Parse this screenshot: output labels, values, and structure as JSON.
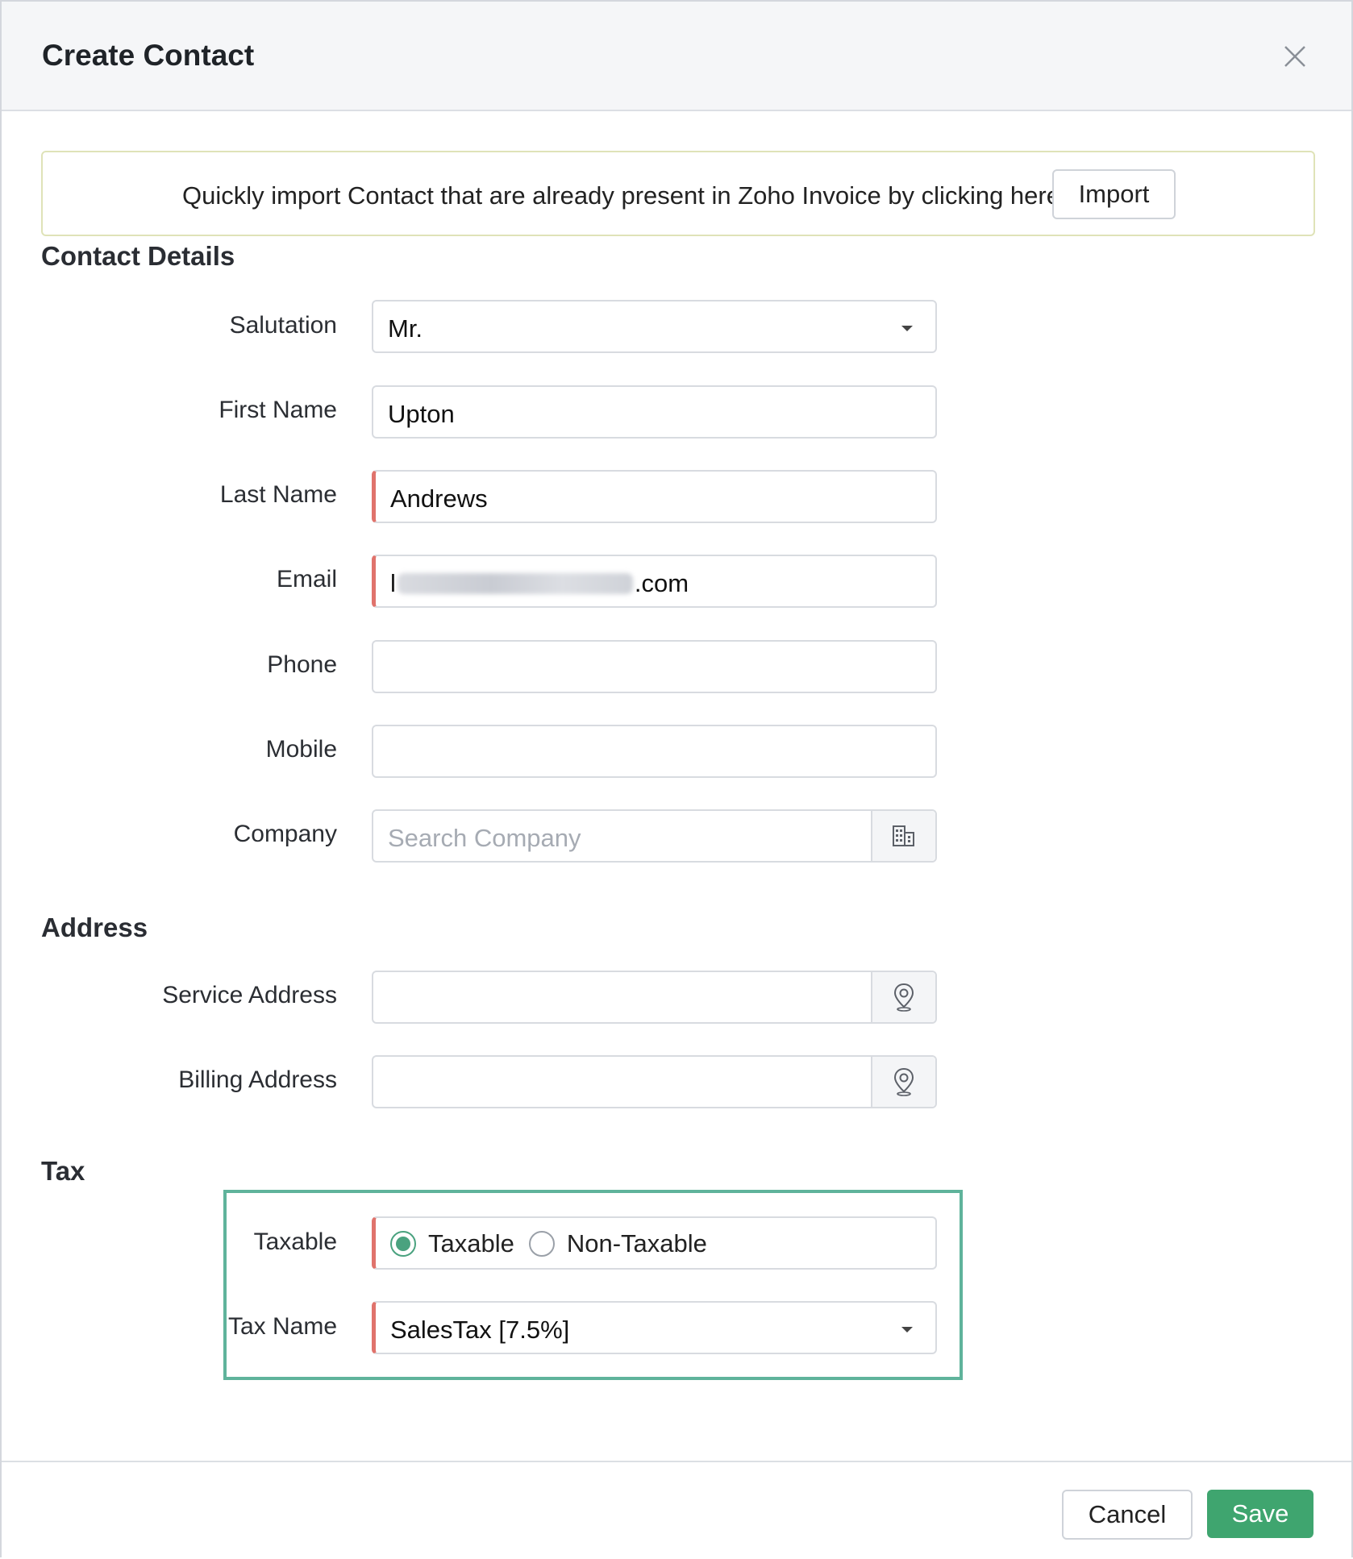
{
  "dialog": {
    "title": "Create Contact",
    "close_icon": "close-icon"
  },
  "import_banner": {
    "message": "Quickly import Contact that are already present in Zoho Invoice by clicking here",
    "button_label": "Import"
  },
  "contact_details": {
    "section_title": "Contact Details",
    "salutation": {
      "label": "Salutation",
      "value": "Mr."
    },
    "first_name": {
      "label": "First Name",
      "value": "Upton"
    },
    "last_name": {
      "label": "Last Name",
      "value": "Andrews"
    },
    "email": {
      "label": "Email",
      "value_start": "l",
      "value_end": ".com"
    },
    "phone": {
      "label": "Phone",
      "value": ""
    },
    "mobile": {
      "label": "Mobile",
      "value": ""
    },
    "company": {
      "label": "Company",
      "placeholder": "Search Company",
      "icon": "building-icon"
    }
  },
  "address": {
    "section_title": "Address",
    "service": {
      "label": "Service Address",
      "icon": "location-pin-icon"
    },
    "billing": {
      "label": "Billing Address",
      "icon": "location-pin-icon"
    }
  },
  "tax": {
    "section_title": "Tax",
    "taxable": {
      "label": "Taxable",
      "options": [
        "Taxable",
        "Non-Taxable"
      ],
      "selected": "Taxable"
    },
    "tax_name": {
      "label": "Tax Name",
      "value": "SalesTax [7.5%]"
    },
    "highlight_color": "#5fb39b"
  },
  "footer": {
    "cancel_label": "Cancel",
    "save_label": "Save",
    "save_color": "#3fa56f"
  },
  "colors": {
    "required_marker": "#e0736c",
    "radio_selected": "#4aa27f"
  }
}
